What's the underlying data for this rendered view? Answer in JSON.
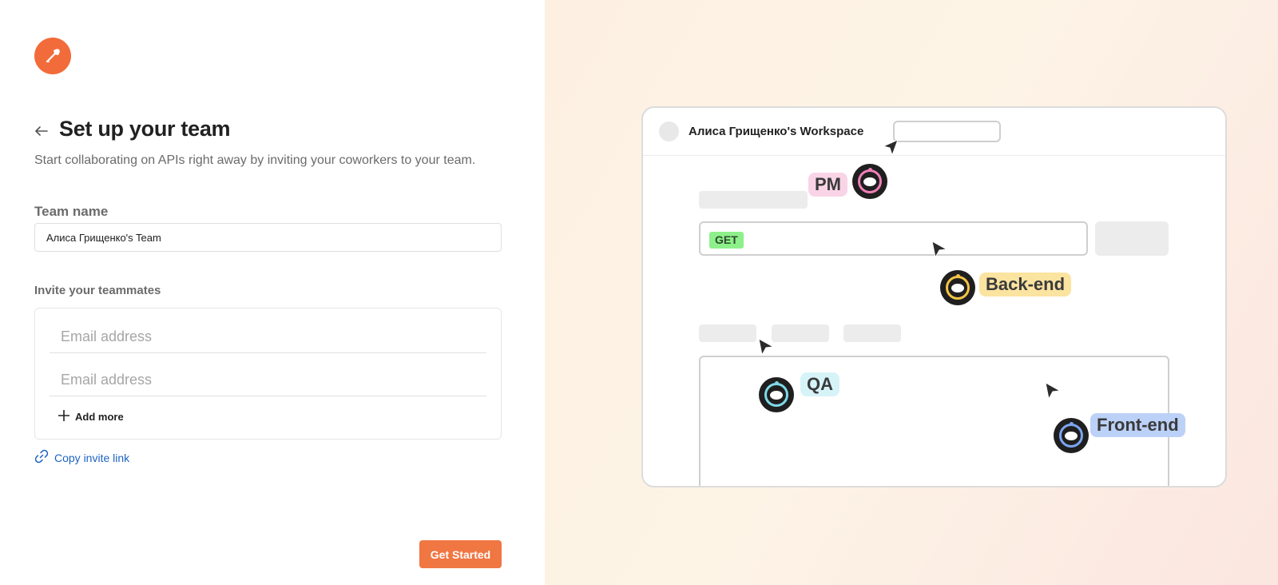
{
  "left": {
    "title": "Set up your team",
    "subtitle": "Start collaborating on APIs right away by inviting your coworkers to your team.",
    "team_name_label": "Team name",
    "team_name_value": "Алиса Грищенко's Team",
    "invite_label": "Invite your teammates",
    "email_placeholder_1": "Email address",
    "email_placeholder_2": "Email address",
    "add_more_label": "Add more",
    "copy_invite_label": "Copy invite link",
    "get_started_label": "Get Started"
  },
  "illustration": {
    "workspace_name": "Алиса Грищенко's Workspace",
    "method_badge": "GET",
    "tags": {
      "pm": "PM",
      "backend": "Back-end",
      "qa": "QA",
      "frontend": "Front-end"
    }
  },
  "colors": {
    "brand_orange": "#f26b3a",
    "button_orange": "#f07642",
    "link_blue": "#1d63c1",
    "pm_pink": "#f9d4e6",
    "backend_yellow": "#fbe3a0",
    "qa_cyan": "#d6f3f8",
    "frontend_blue": "#bcd1f7",
    "get_green": "#8ef08a"
  },
  "icons": [
    "postman-logo-icon",
    "arrow-left-icon",
    "plus-icon",
    "link-icon",
    "cursor-icon",
    "avatar-icon"
  ]
}
